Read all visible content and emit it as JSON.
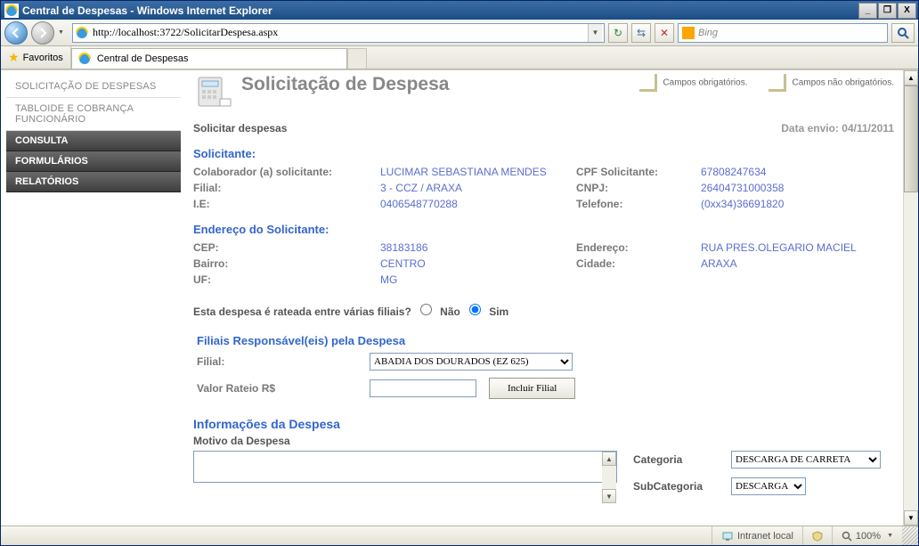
{
  "window": {
    "title": "Central de Despesas - Windows Internet Explorer"
  },
  "nav": {
    "url": "http://localhost:3722/SolicitarDespesa.aspx",
    "search_placeholder": "Bing"
  },
  "favbar": {
    "favorites": "Favoritos",
    "tab_title": "Central de Despesas"
  },
  "sidebar": {
    "items": [
      "SOLICITAÇÃO DE DESPESAS",
      "TABLOIDE E COBRANÇA FUNCIONÁRIO"
    ],
    "headers": [
      "CONSULTA",
      "FORMULÁRIOS",
      "RELATÓRIOS"
    ]
  },
  "page": {
    "title": "Solicitação de Despesa",
    "legend_required": "Campos obrigatórios.",
    "legend_optional": "Campos não obrigatórios.",
    "subtitle": "Solicitar despesas",
    "date_label": "Data envio:",
    "date_value": "04/11/2011"
  },
  "solicitante": {
    "heading": "Solicitante:",
    "colab_label": "Colaborador (a) solicitante:",
    "colab_value": "LUCIMAR SEBASTIANA MENDES",
    "cpf_label": "CPF Solicitante:",
    "cpf_value": "67808247634",
    "filial_label": "Filial:",
    "filial_value": "3 - CCZ / ARAXA",
    "cnpj_label": "CNPJ:",
    "cnpj_value": "26404731000358",
    "ie_label": "I.E:",
    "ie_value": "0406548770288",
    "tel_label": "Telefone:",
    "tel_value": "(0xx34)36691820"
  },
  "endereco": {
    "heading": "Endereço do Solicitante:",
    "cep_label": "CEP:",
    "cep_value": "38183186",
    "end_label": "Endereço:",
    "end_value": "RUA PRES.OLEGARIO MACIEL",
    "bairro_label": "Bairro:",
    "bairro_value": "CENTRO",
    "cidade_label": "Cidade:",
    "cidade_value": "ARAXA",
    "uf_label": "UF:",
    "uf_value": "MG"
  },
  "rateio": {
    "question": "Esta despesa é rateada entre várias filiais?",
    "nao": "Não",
    "sim": "Sim",
    "selected": "sim"
  },
  "filiais": {
    "heading": "Filiais Responsável(eis) pela Despesa",
    "filial_label": "Filial:",
    "filial_select": "ABADIA DOS DOURADOS (EZ 625)",
    "valor_label": "Valor Rateio R$",
    "valor_value": "",
    "incluir_btn": "Incluir Filial"
  },
  "info": {
    "heading": "Informações da Despesa",
    "motivo_label": "Motivo da Despesa",
    "motivo_value": "",
    "categoria_label": "Categoria",
    "categoria_value": "DESCARGA DE CARRETA",
    "subcat_label": "SubCategoria",
    "subcat_value": "DESCARGA"
  },
  "status": {
    "zone": "Intranet local",
    "zoom": "100%"
  }
}
